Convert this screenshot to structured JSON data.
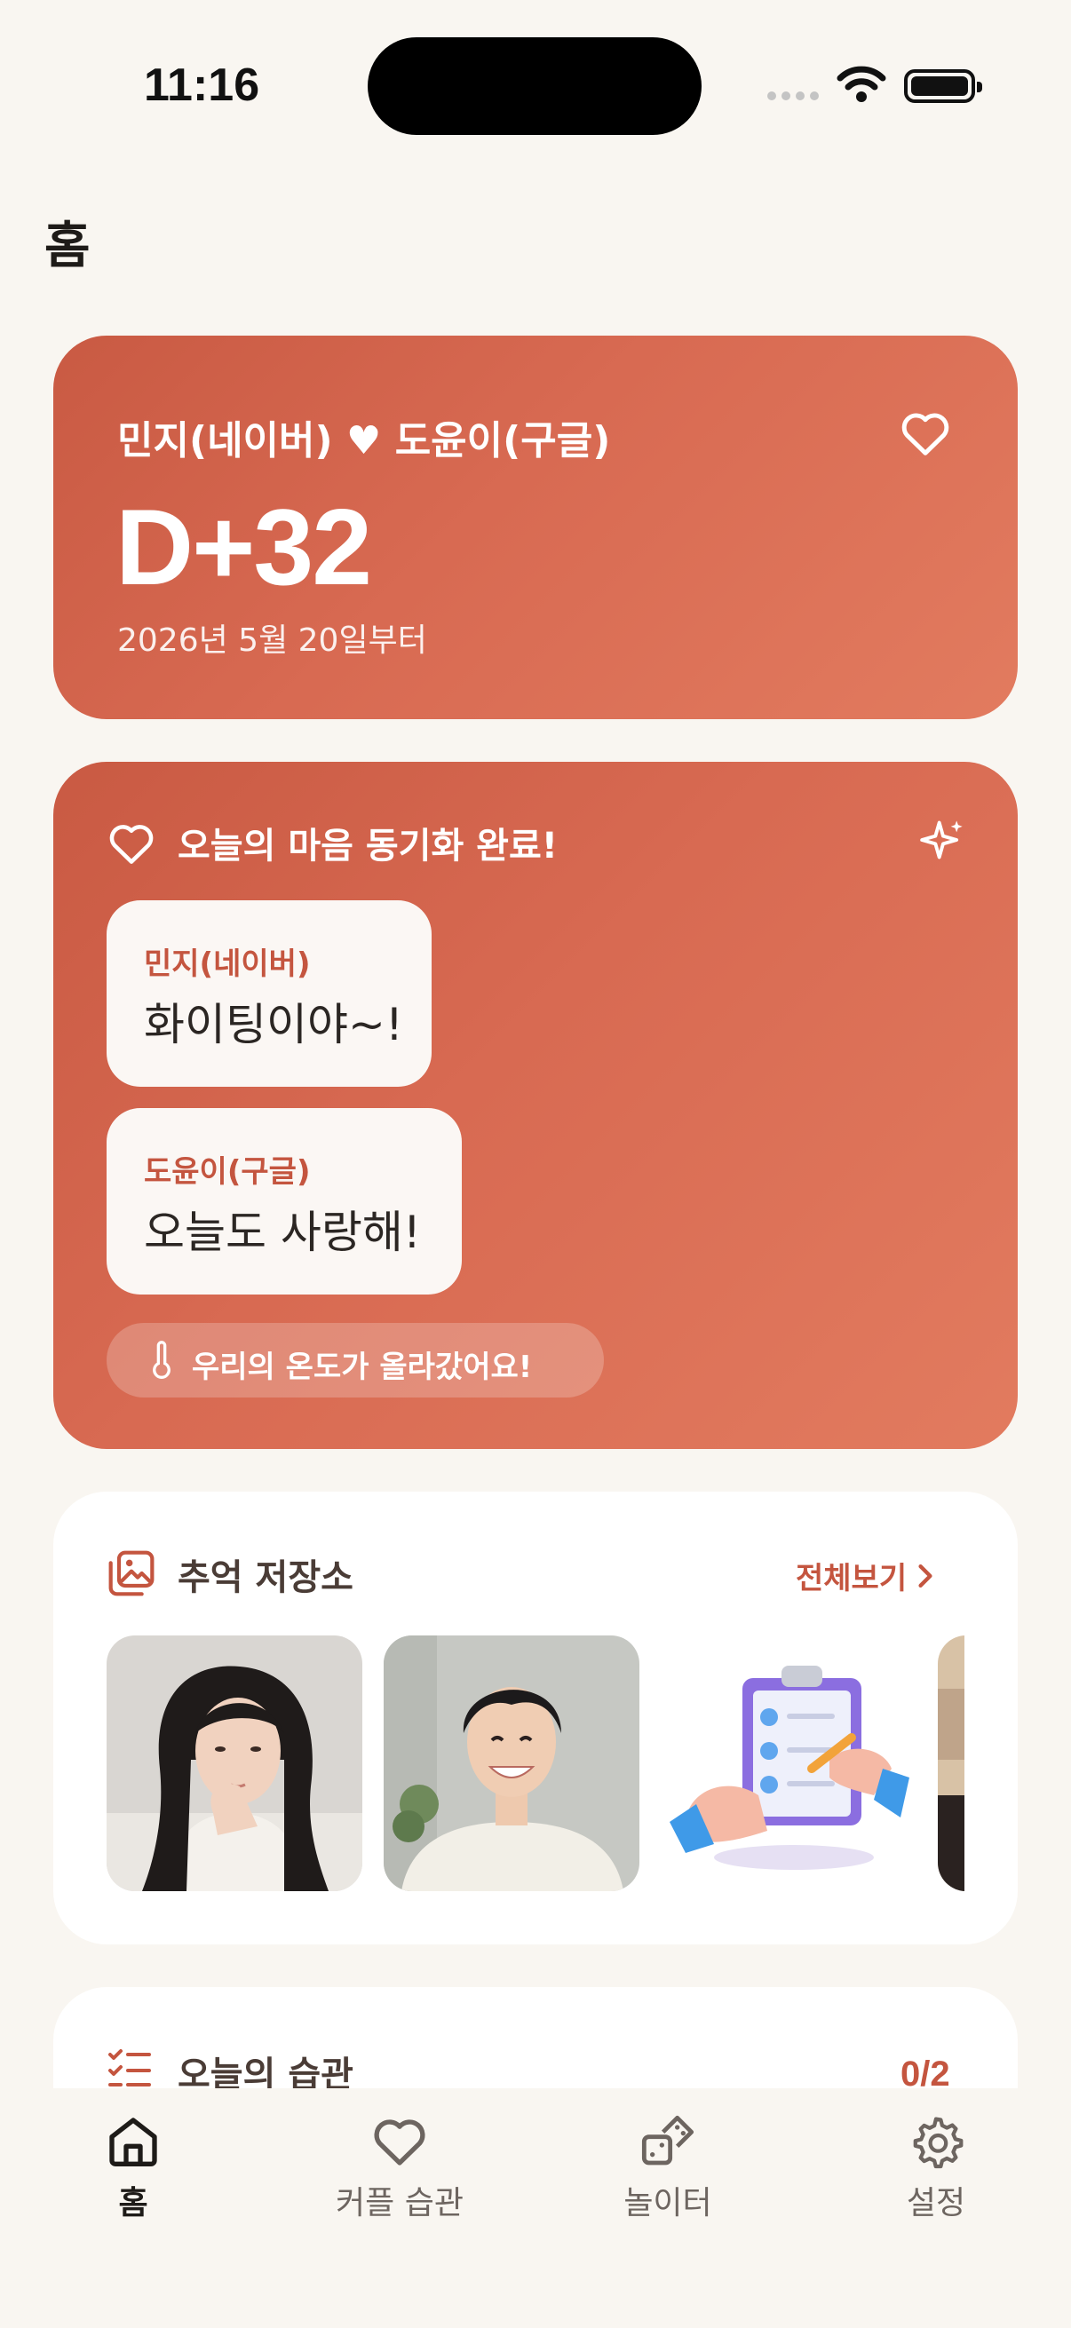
{
  "status_bar": {
    "time": "11:16"
  },
  "page": {
    "title": "홈"
  },
  "couple_card": {
    "names": "민지(네이버) ♥ 도윤이(구글)",
    "dday": "D+32",
    "since": "2026년 5월 20일부터"
  },
  "sync_card": {
    "title": "오늘의 마음 동기화 완료!",
    "messages": [
      {
        "name": "민지(네이버)",
        "text": "화이팅이야~!"
      },
      {
        "name": "도윤이(구글)",
        "text": "오늘도 사랑해!"
      }
    ],
    "temperature_text": "우리의 온도가 올라갔어요!"
  },
  "memory_card": {
    "title": "추억 저장소",
    "see_all": "전체보기"
  },
  "habit_card": {
    "title": "오늘의 습관",
    "count": "0/2"
  },
  "tab_bar": {
    "items": [
      {
        "label": "홈",
        "icon": "home-icon",
        "active": true
      },
      {
        "label": "커플 습관",
        "icon": "heart-icon",
        "active": false
      },
      {
        "label": "놀이터",
        "icon": "dice-icon",
        "active": false
      },
      {
        "label": "설정",
        "icon": "gear-icon",
        "active": false
      }
    ]
  },
  "colors": {
    "background": "#f9f6f1",
    "accent": "#c4553f",
    "gradient_start": "#c95a43",
    "gradient_end": "#e27b5f"
  }
}
